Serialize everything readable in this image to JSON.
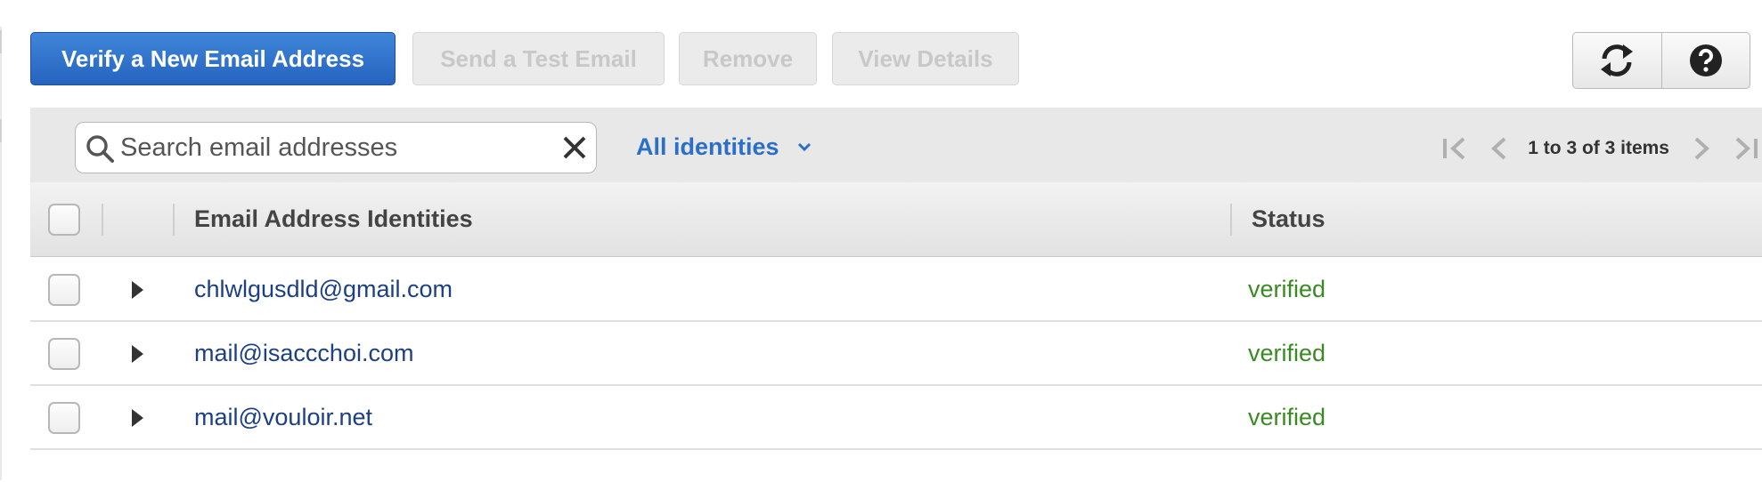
{
  "toolbar": {
    "verify_label": "Verify a New Email Address",
    "send_test_label": "Send a Test Email",
    "remove_label": "Remove",
    "view_details_label": "View Details"
  },
  "icons": {
    "refresh": "refresh-icon",
    "help": "help-icon"
  },
  "search": {
    "placeholder": "Search email addresses",
    "value": ""
  },
  "filter": {
    "label": "All identities"
  },
  "pagination": {
    "text": "1 to 3 of 3 items"
  },
  "table": {
    "columns": [
      "Email Address Identities",
      "Status"
    ],
    "rows": [
      {
        "email": "chlwlgusdld@gmail.com",
        "status": "verified"
      },
      {
        "email": "mail@isaccchoi.com",
        "status": "verified"
      },
      {
        "email": "mail@vouloir.net",
        "status": "verified"
      }
    ]
  },
  "colors": {
    "primary_button": "#2e6ecd",
    "link_text": "#1d3f84",
    "filter_text": "#2c6fc7",
    "status_verified": "#3a8a24"
  }
}
